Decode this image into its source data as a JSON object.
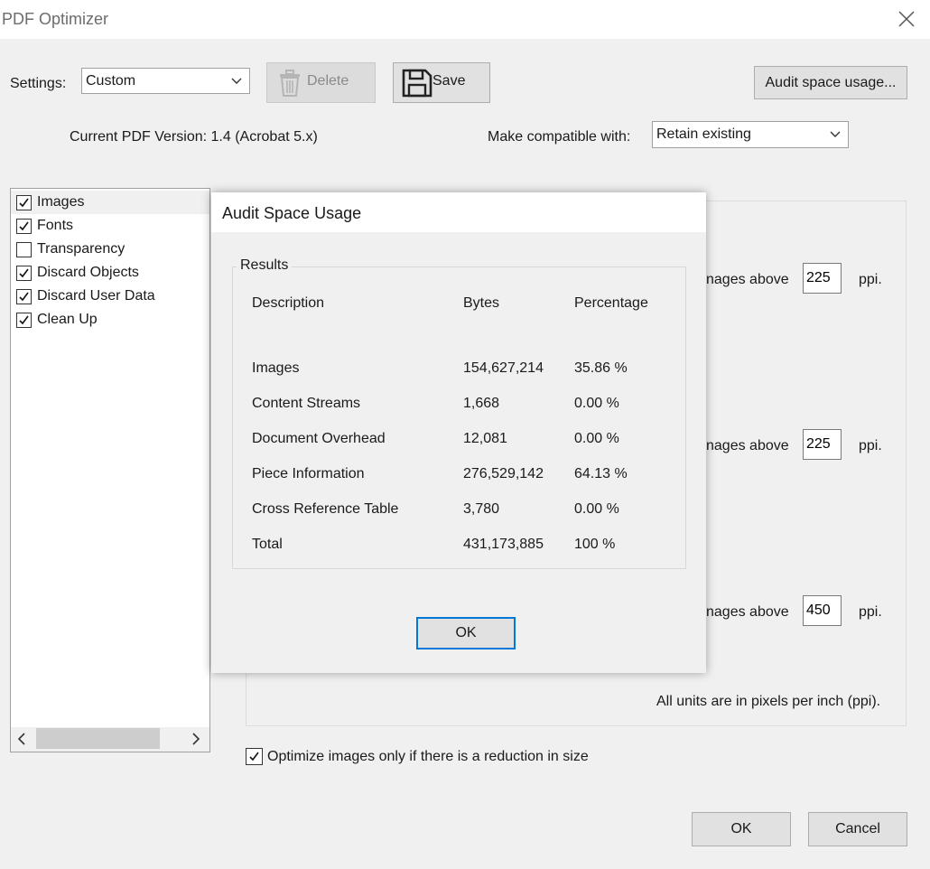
{
  "window": {
    "title": "PDF Optimizer"
  },
  "toolbar": {
    "settings_label": "Settings:",
    "settings_value": "Custom",
    "delete_label": "Delete",
    "save_label": "Save",
    "audit_label": "Audit space usage..."
  },
  "version": {
    "current": "Current PDF Version: 1.4 (Acrobat 5.x)",
    "compat_label": "Make compatible with:",
    "compat_value": "Retain existing"
  },
  "categories": [
    {
      "label": "Images",
      "checked": true
    },
    {
      "label": "Fonts",
      "checked": true
    },
    {
      "label": "Transparency",
      "checked": false
    },
    {
      "label": "Discard Objects",
      "checked": true
    },
    {
      "label": "Discard User Data",
      "checked": true
    },
    {
      "label": "Clean Up",
      "checked": true
    }
  ],
  "images_panel": {
    "rows": [
      {
        "text": "nages above",
        "value": "225",
        "unit": "ppi."
      },
      {
        "text": "nages above",
        "value": "225",
        "unit": "ppi."
      },
      {
        "text": "nages above",
        "value": "450",
        "unit": "ppi."
      }
    ],
    "units_note": "All units are in pixels per inch (ppi)."
  },
  "optimize_checkbox": {
    "label": "Optimize images only if there is a reduction in size",
    "checked": true
  },
  "footer": {
    "ok_label": "OK",
    "cancel_label": "Cancel"
  },
  "audit_dialog": {
    "title": "Audit Space Usage",
    "group_label": "Results",
    "headers": {
      "description": "Description",
      "bytes": "Bytes",
      "percentage": "Percentage"
    },
    "rows": [
      {
        "description": "Images",
        "bytes": "154,627,214",
        "percentage": "35.86 %"
      },
      {
        "description": "Content Streams",
        "bytes": "1,668",
        "percentage": "0.00 %"
      },
      {
        "description": "Document Overhead",
        "bytes": "12,081",
        "percentage": "0.00 %"
      },
      {
        "description": "Piece Information",
        "bytes": "276,529,142",
        "percentage": "64.13 %"
      },
      {
        "description": "Cross Reference Table",
        "bytes": "3,780",
        "percentage": "0.00 %"
      },
      {
        "description": "Total",
        "bytes": "431,173,885",
        "percentage": "100 %"
      }
    ],
    "ok_label": "OK"
  },
  "colors": {
    "focus_border": "#0078d7",
    "window_bg": "#f0f0f0",
    "titlebar_bg": "#ffffff"
  }
}
